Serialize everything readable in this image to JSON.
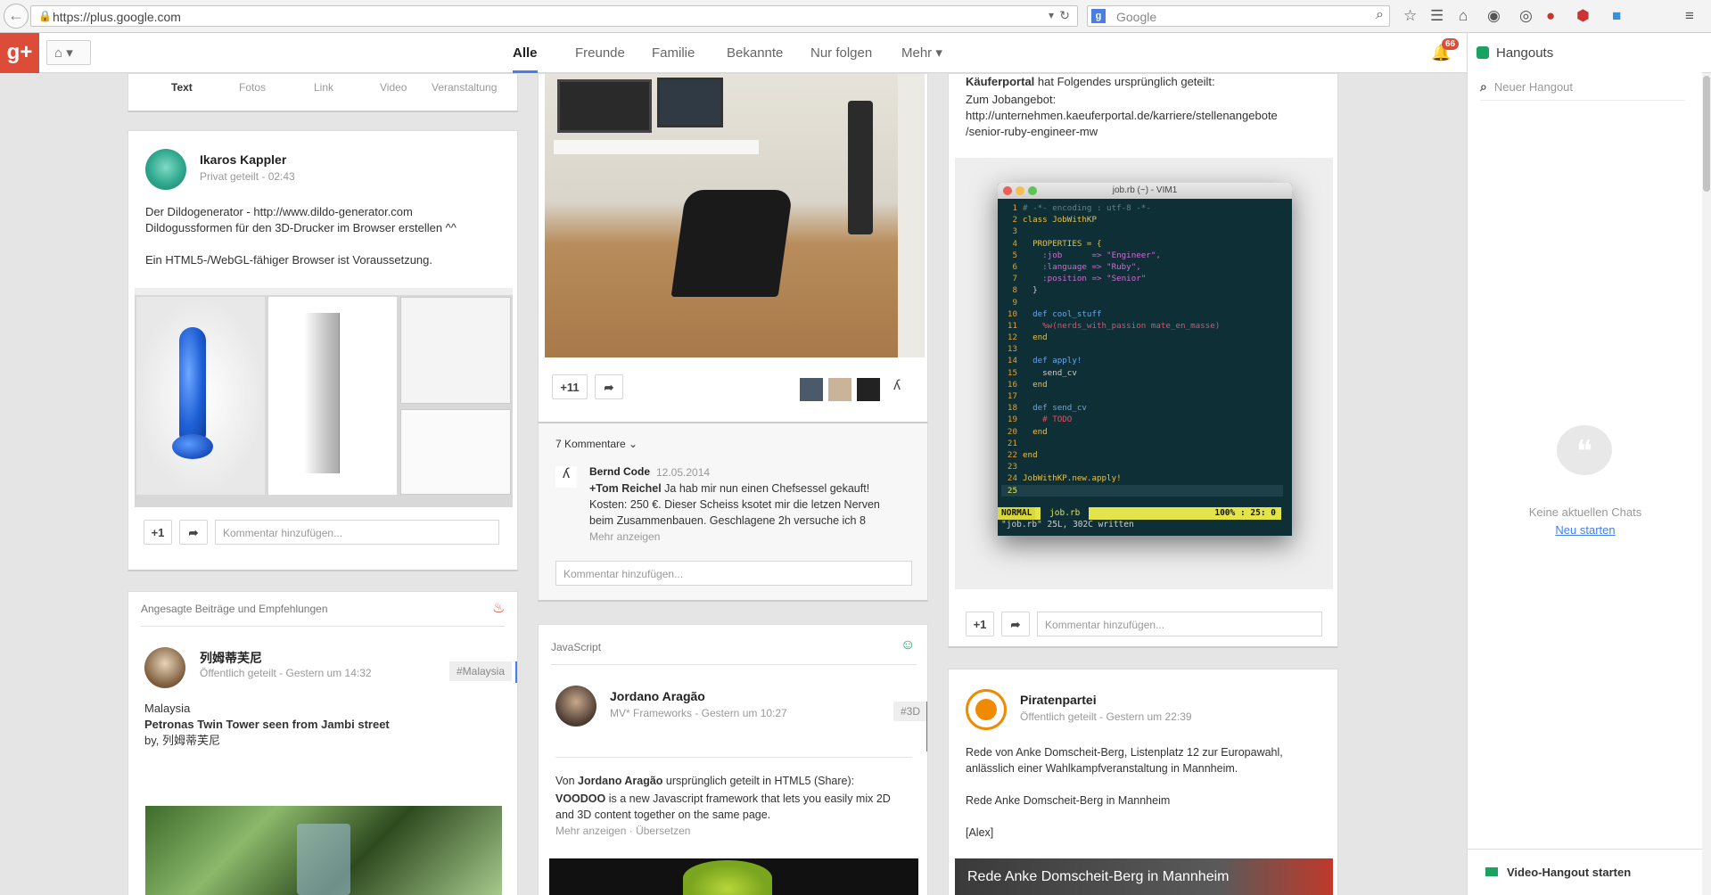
{
  "browser": {
    "url": "https://plus.google.com",
    "search_placeholder": "Google"
  },
  "gplus": {
    "logo": "g+",
    "streams": [
      "Alle",
      "Freunde",
      "Familie",
      "Bekannte",
      "Nur folgen",
      "Mehr ▾"
    ],
    "notifications_count": "66"
  },
  "hangouts": {
    "title": "Hangouts",
    "search_placeholder": "Neuer Hangout",
    "no_chats": "Keine aktuellen Chats",
    "start_new": "Neu starten",
    "video_hangout": "Video-Hangout starten"
  },
  "composer": {
    "tabs": [
      "Text",
      "Fotos",
      "Link",
      "Video",
      "Veranstaltung"
    ]
  },
  "post1": {
    "author": "Ikaros Kappler",
    "meta": "Privat geteilt  -  02:43",
    "line1": "Der Dildogenerator - http://www.dildo-generator.com",
    "line2": "Dildogussformen für den 3D-Drucker im Browser erstellen ^^",
    "line3": "Ein HTML5-/WebGL-fähiger Browser ist Voraussetzung.",
    "plus": "+1",
    "comment_placeholder": "Kommentar hinzufügen..."
  },
  "recommend": {
    "header": "Angesagte Beiträge und Empfehlungen",
    "author": "列姆蒂芙尼",
    "meta": "Öffentlich geteilt  -  Gestern um 14:32",
    "tag": "#Malaysia",
    "line1": "Malaysia",
    "line2": "Petronas Twin Tower seen from Jambi street",
    "line3": "by, 列姆蒂芙尼"
  },
  "post2": {
    "plus": "+11",
    "comments_toggle": "7 Kommentare",
    "commenter": "Bernd Code",
    "comment_date": "12.05.2014",
    "mention": "+Tom Reichel",
    "comment_l1": " Ja hab mir nun einen Chefsessel gekauft!",
    "comment_l2": "Kosten: 250 €. Dieser Scheiss ksotet mir die letzen Nerven",
    "comment_l3": "beim Zusammenbauen. Geschlagene 2h versuche ich 8",
    "more": "Mehr anzeigen",
    "comment_placeholder": "Kommentar hinzufügen..."
  },
  "post3": {
    "community": "JavaScript",
    "author": "Jordano Aragão",
    "meta": "MV* Frameworks  -  Gestern um 10:27",
    "tag": "#3D",
    "reshare_pre": "Von ",
    "reshare_author": "Jordano Aragão",
    "reshare_post": " ursprünglich geteilt in HTML5 (Share):",
    "voodoo": "VOODOO",
    "body1": " is a new Javascript framework that lets you easily mix 2D",
    "body2": "and 3D content together on the same page.",
    "more": "Mehr anzeigen",
    "translate": "Übersetzen"
  },
  "post4": {
    "shared_by": "Käuferportal",
    "shared_suffix": " hat Folgendes ursprünglich geteilt:",
    "line1": "Zum Jobangebot:",
    "line2": "http://unternehmen.kaeuferportal.de/karriere/stellenangebote",
    "line3": "/senior-ruby-engineer-mw",
    "vim_title": "job.rb (~) - VIM1",
    "vim_mode": "NORMAL",
    "vim_file": "job.rb",
    "vim_pos": "100% :  25:  0",
    "vim_msg": "\"job.rb\" 25L, 302C written",
    "plus": "+1",
    "comment_placeholder": "Kommentar hinzufügen..."
  },
  "post5": {
    "author": "Piratenpartei",
    "meta": "Öffentlich geteilt  -  Gestern um 22:39",
    "line1": "Rede von Anke Domscheit-Berg, Listenplatz 12 zur Europawahl,",
    "line2": "anlässlich einer Wahlkampfveranstaltung in Mannheim.",
    "line3": "Rede Anke Domscheit-Berg in Mannheim",
    "line4": "[Alex]",
    "video_title": "Rede Anke Domscheit-Berg in Mannheim"
  },
  "code_lines": [
    {
      "n": "1",
      "t": "# -*- encoding : utf-8 -*-",
      "c": "#6b7f86"
    },
    {
      "n": "2",
      "t": "class JobWithKP",
      "c": "#e4c24d"
    },
    {
      "n": "3",
      "t": "",
      "c": "#ccc"
    },
    {
      "n": "4",
      "t": "  PROPERTIES = {",
      "c": "#e4c24d"
    },
    {
      "n": "5",
      "t": "    :job      => \"Engineer\",",
      "c": "#d16bd1"
    },
    {
      "n": "6",
      "t": "    :language => \"Ruby\",",
      "c": "#d16bd1"
    },
    {
      "n": "7",
      "t": "    :position => \"Senior\"",
      "c": "#d16bd1"
    },
    {
      "n": "8",
      "t": "  }",
      "c": "#ccc"
    },
    {
      "n": "9",
      "t": "",
      "c": "#ccc"
    },
    {
      "n": "10",
      "t": "  def cool_stuff",
      "c": "#6aa6e6"
    },
    {
      "n": "11",
      "t": "    %w(nerds_with_passion mate_en_masse)",
      "c": "#e0506b"
    },
    {
      "n": "12",
      "t": "  end",
      "c": "#e4c24d"
    },
    {
      "n": "13",
      "t": "",
      "c": "#ccc"
    },
    {
      "n": "14",
      "t": "  def apply!",
      "c": "#6aa6e6"
    },
    {
      "n": "15",
      "t": "    send_cv",
      "c": "#ccc"
    },
    {
      "n": "16",
      "t": "  end",
      "c": "#e4c24d"
    },
    {
      "n": "17",
      "t": "",
      "c": "#ccc"
    },
    {
      "n": "18",
      "t": "  def send_cv",
      "c": "#6aa6e6"
    },
    {
      "n": "19",
      "t": "    # TODO",
      "c": "#e0506b"
    },
    {
      "n": "20",
      "t": "  end",
      "c": "#e4c24d"
    },
    {
      "n": "21",
      "t": "",
      "c": "#ccc"
    },
    {
      "n": "22",
      "t": "end",
      "c": "#e4c24d"
    },
    {
      "n": "23",
      "t": "",
      "c": "#ccc"
    },
    {
      "n": "24",
      "t": "JobWithKP.new.apply!",
      "c": "#e4c24d"
    },
    {
      "n": "25",
      "t": "",
      "c": "#ccc"
    }
  ],
  "colors": {
    "brand": "#dd4b39",
    "accent": "#427fed",
    "hangout_green": "#1aa260"
  }
}
